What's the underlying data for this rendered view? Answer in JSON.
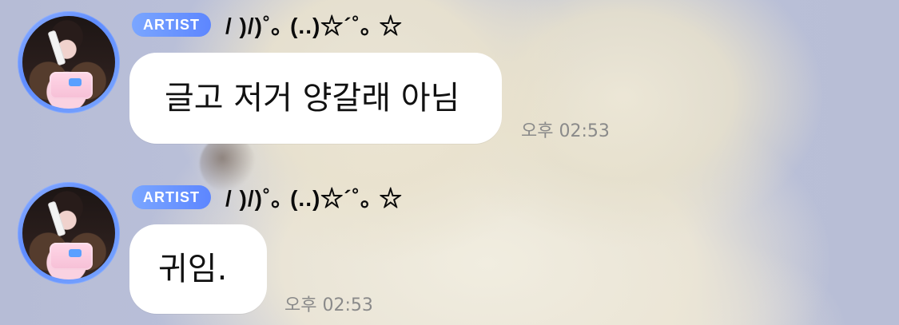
{
  "messages": [
    {
      "sender": {
        "badge": "ARTIST",
        "name": "/ )/)˚｡ (..)☆´˚｡ ☆",
        "avatar_icon": "profile-photo"
      },
      "text": "글고 저거 양갈래 아님",
      "time": "오후 02:53"
    },
    {
      "sender": {
        "badge": "ARTIST",
        "name": "/ )/)˚｡ (..)☆´˚｡ ☆",
        "avatar_icon": "profile-photo"
      },
      "text": "귀임.",
      "time": "오후 02:53"
    }
  ],
  "colors": {
    "badge_gradient_start": "#7aa6ff",
    "badge_gradient_end": "#5d86ff",
    "bubble_bg": "#ffffff",
    "time_text": "#8a8a8a"
  }
}
